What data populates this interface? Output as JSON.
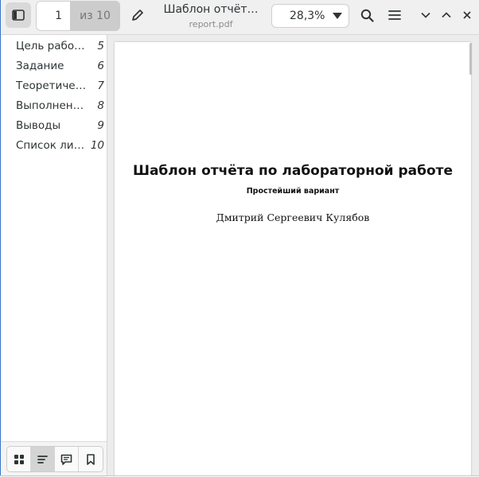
{
  "header": {
    "page_number": "1",
    "page_total": "из 10",
    "doc_title": "Шаблон отчёт…",
    "doc_filename": "report.pdf",
    "zoom": "28,3%"
  },
  "sidebar": {
    "outline": [
      {
        "label": "Цель работы",
        "page": "5"
      },
      {
        "label": "Задание",
        "page": "6"
      },
      {
        "label": "Теоретиче…",
        "page": "7"
      },
      {
        "label": "Выполнени…",
        "page": "8"
      },
      {
        "label": "Выводы",
        "page": "9"
      },
      {
        "label": "Список лит…",
        "page": "10"
      }
    ],
    "tabs": [
      {
        "icon": "thumbnails-icon",
        "active": false
      },
      {
        "icon": "outline-icon",
        "active": true
      },
      {
        "icon": "annotations-icon",
        "active": false
      },
      {
        "icon": "bookmarks-icon",
        "active": false
      }
    ]
  },
  "document": {
    "title": "Шаблон отчёта по лабораторной работе",
    "subtitle": "Простейший вариант",
    "author": "Дмитрий Сергеевич Кулябов"
  },
  "colors": {
    "window_accent": "#3a76c4",
    "headerbar_bg": "#f0f0f0",
    "doc_background": "#ececec"
  }
}
